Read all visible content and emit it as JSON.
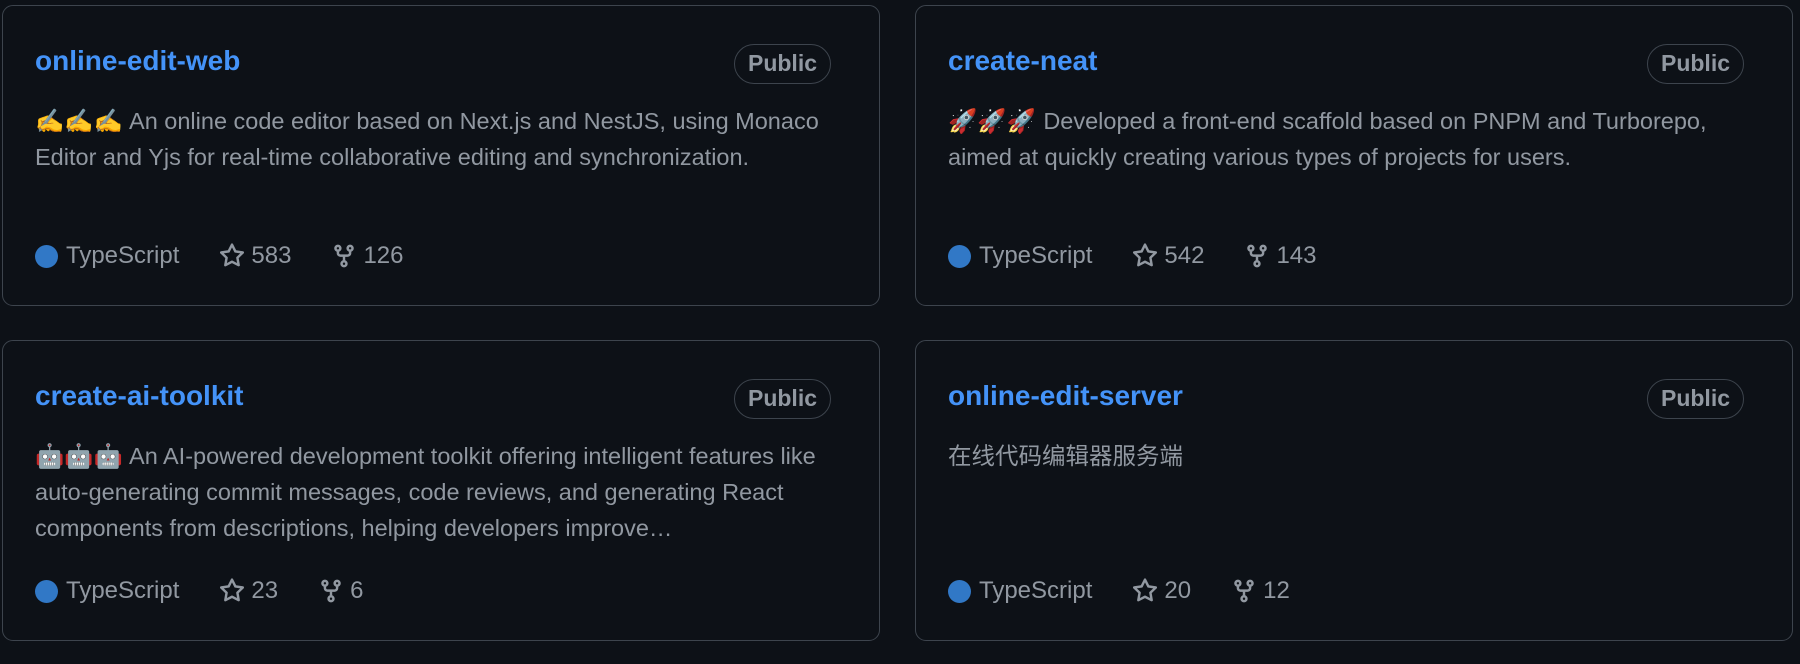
{
  "repos": [
    {
      "name": "online-edit-web",
      "visibility": "Public",
      "emoji": "✍️✍️✍️",
      "description": "An online code editor based on Next.js and NestJS, using Monaco Editor and Yjs for real-time collaborative editing and synchronization.",
      "language": "TypeScript",
      "stars": "583",
      "forks": "126"
    },
    {
      "name": "create-neat",
      "visibility": "Public",
      "emoji": "🚀🚀🚀",
      "description": "Developed a front-end scaffold based on PNPM and Turborepo, aimed at quickly creating various types of projects for users.",
      "language": "TypeScript",
      "stars": "542",
      "forks": "143"
    },
    {
      "name": "create-ai-toolkit",
      "visibility": "Public",
      "emoji": "🤖🤖🤖",
      "description": "An AI-powered development toolkit offering intelligent features like auto-generating commit messages, code reviews, and generating React components from descriptions, helping developers improve…",
      "language": "TypeScript",
      "stars": "23",
      "forks": "6"
    },
    {
      "name": "online-edit-server",
      "visibility": "Public",
      "emoji": "",
      "description": "在线代码编辑器服务端",
      "language": "TypeScript",
      "stars": "20",
      "forks": "12"
    }
  ],
  "colors": {
    "background": "#0d1117",
    "border": "#3d444d",
    "link": "#4493f8",
    "muted_text": "#9198a1",
    "typescript": "#3178c6"
  },
  "icons": {
    "star": "star-icon",
    "fork": "repo-forked-icon",
    "language": "language-color-dot"
  }
}
